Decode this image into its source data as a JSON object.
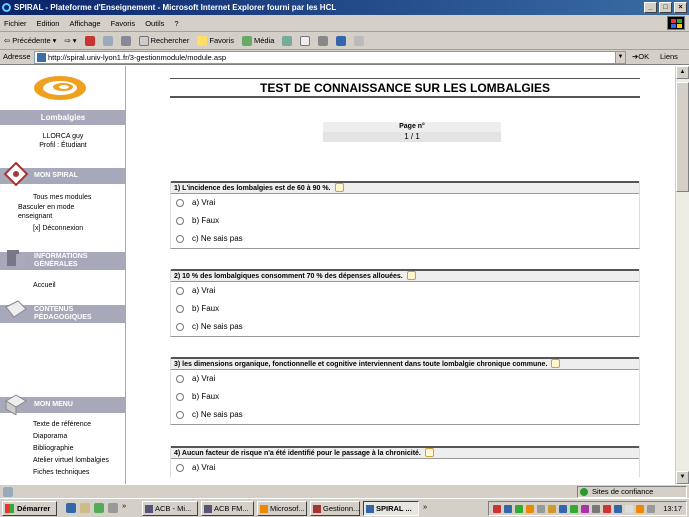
{
  "window": {
    "title": "SPIRAL - Plateforme d'Enseignement - Microsoft Internet Explorer fourni par les HCL",
    "controls": [
      "_",
      "□",
      "×"
    ]
  },
  "menu": [
    "Fichier",
    "Edition",
    "Affichage",
    "Favoris",
    "Outils",
    "?"
  ],
  "toolbar": {
    "back": "Précédente",
    "search": "Rechercher",
    "favorites": "Favoris",
    "media": "Média"
  },
  "address": {
    "label": "Adresse",
    "url": "http://spiral.univ-lyon1.fr/3-gestionmodule/module.asp",
    "go": "OK",
    "links": "Liens"
  },
  "sidebar": {
    "module": "Lombalgies",
    "user_name": "LLORCA guy",
    "user_profile": "Profil : Étudiant",
    "sections": {
      "mon_spiral": "MON SPIRAL",
      "informations": "INFORMATIONS GÉNÉRALES",
      "contenus": "CONTENUS PÉDAGOGIQUES",
      "mon_menu": "MON MENU"
    },
    "mon_spiral_links": [
      "Tous mes modules",
      "Basculer en mode enseignant",
      "[x]  Déconnexion"
    ],
    "info_links": [
      "Accueil"
    ],
    "menu_links": [
      "Texte de référence",
      "Diaporama",
      "Bibliographie",
      "Atelier virtuel lombalgies",
      "Fiches techniques"
    ]
  },
  "main": {
    "title": "TEST DE CONNAISSANCE SUR LES LOMBALGIES",
    "page_label": "Page n°",
    "page_value": "1 / 1",
    "questions": [
      {
        "text": "1) L'incidence des lombalgies est de 60 à 90 %.",
        "options": [
          "a) Vrai",
          "b) Faux",
          "c) Ne sais pas"
        ]
      },
      {
        "text": "2) 10 % des lombalgiques consomment 70 % des dépenses allouées.",
        "options": [
          "a) Vrai",
          "b) Faux",
          "c)  Ne sais pas"
        ]
      },
      {
        "text": "3) les dimensions organique, fonctionnelle et cognitive interviennent dans toute lombalgie chronique commune.",
        "options": [
          "a) Vrai",
          "b) Faux",
          "c)  Ne sais pas"
        ]
      },
      {
        "text": "4) Aucun facteur de risque n'a été identifié pour le passage à la chronicité.",
        "options": [
          "a) Vrai"
        ]
      }
    ]
  },
  "status": {
    "zone": "Sites de confiance"
  },
  "taskbar": {
    "start": "Démarrer",
    "tasks": [
      "ACB - Mi...",
      "ACB FM...",
      "Microsof...",
      "Gestionn...",
      "SPIRAL ..."
    ],
    "clock": "13:17"
  },
  "colors": {
    "title_bar": "#0a246a",
    "sidebar_band": "#a8a8bb",
    "chrome": "#d4d0c8",
    "logo_orange": "#f0a020"
  }
}
